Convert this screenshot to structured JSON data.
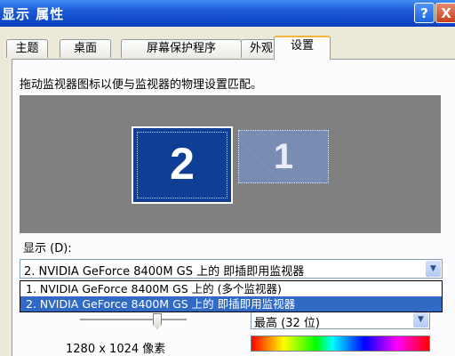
{
  "window": {
    "title": "显示 属性",
    "help_label": "?",
    "close_label": "X"
  },
  "tabs": [
    {
      "label": "主题"
    },
    {
      "label": "桌面"
    },
    {
      "label": "屏幕保护程序"
    },
    {
      "label": "外观"
    },
    {
      "label": "设置"
    }
  ],
  "settings": {
    "instruction": "拖动监视器图标以便与监视器的物理设置匹配。",
    "monitors": [
      {
        "number": "2",
        "selected": true
      },
      {
        "number": "1",
        "selected": false
      }
    ],
    "display_label": "显示 (D):",
    "display_selected": "2. NVIDIA GeForce 8400M GS 上的 即插即用监视器",
    "display_options": [
      "1. NVIDIA GeForce 8400M GS 上的 (多个监视器)",
      "2. NVIDIA GeForce 8400M GS 上的 即插即用监视器"
    ],
    "resolution": "1280 x 1024 像素",
    "color_quality": "最高 (32 位)"
  },
  "colors": {
    "titlebar": "#0a3fbf",
    "selected_monitor": "#0f3f95",
    "highlight": "#316ac5"
  }
}
